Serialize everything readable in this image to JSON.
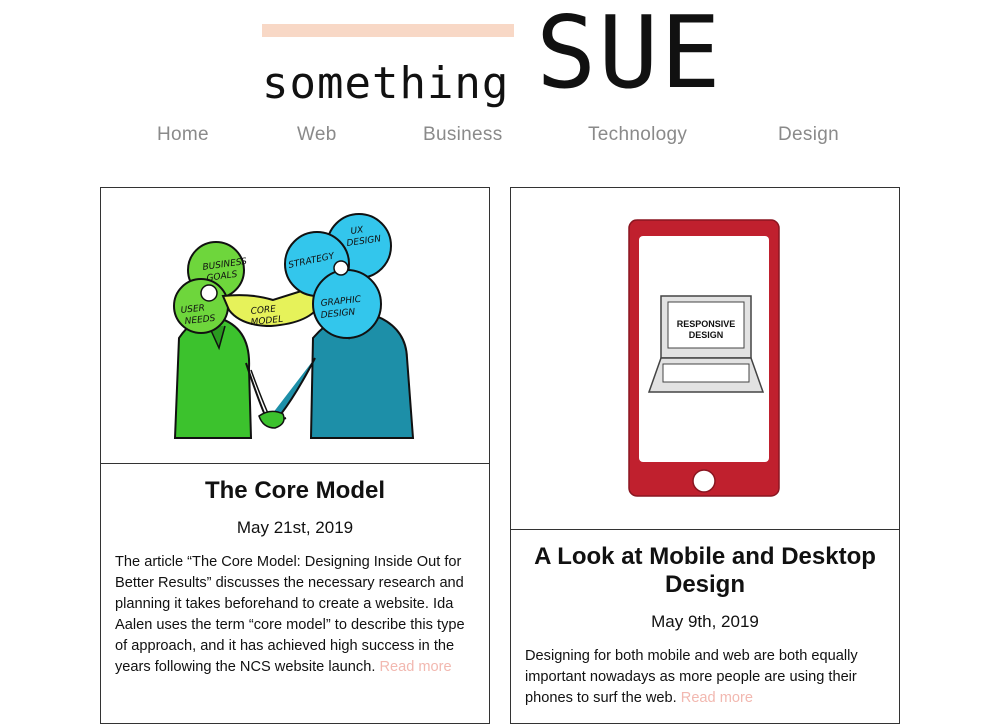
{
  "site": {
    "logo_small": "something",
    "logo_big": "SUE",
    "accent_color": "#f8d8c6"
  },
  "nav": {
    "items": [
      {
        "label": "Home"
      },
      {
        "label": "Web"
      },
      {
        "label": "Business"
      },
      {
        "label": "Technology"
      },
      {
        "label": "Design"
      }
    ]
  },
  "posts": [
    {
      "title": "The Core Model",
      "date": "May 21st, 2019",
      "excerpt": "The article “The Core Model: Designing Inside Out for Better Results” discusses the necessary research and planning it takes beforehand to create a website. Ida Aalen uses the term “core model” to describe this type of approach, and it has achieved high success in the years following the NCS website launch.",
      "read_more": "Read more",
      "image": {
        "labels": [
          "BUSINESS",
          "GOALS",
          "USER",
          "NEEDS",
          "CORE",
          "MODEL",
          "STRATEGY",
          "UX",
          "DESIGN",
          "GRAPHIC",
          "DESIGN"
        ]
      }
    },
    {
      "title": "A Look at Mobile and Desktop Design",
      "date": "May 9th, 2019",
      "excerpt": "Designing for both mobile and web are both equally important nowadays as more people are using their phones to surf the web.",
      "read_more": "Read more",
      "image": {
        "labels": [
          "RESPONSIVE",
          "DESIGN"
        ]
      }
    }
  ]
}
